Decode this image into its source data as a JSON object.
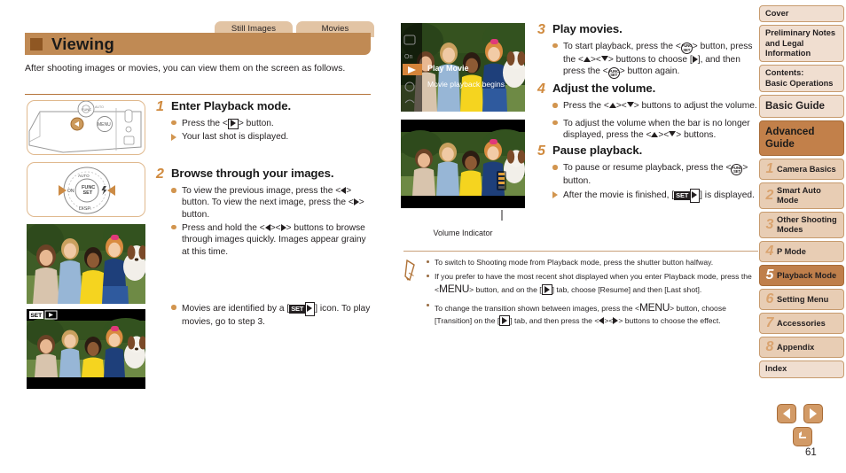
{
  "tabs": [
    {
      "label": "Still Images"
    },
    {
      "label": "Movies"
    }
  ],
  "title": "Viewing",
  "intro": "After shooting images or movies, you can view them on the screen as follows.",
  "page_number": "61",
  "colors": {
    "accent_brown": "#c08a54",
    "dark_brown": "#8f5723",
    "tab_tan": "#e2c4a4",
    "bullet_orange": "#d2954f",
    "step_number": "#d08a3e",
    "sidebar_bg": "#f0ded0",
    "sidebar_active": "#bf7f4b",
    "sidebar_advanced": "#c2804a"
  },
  "steps": [
    {
      "num": "1",
      "title": "Enter Playback mode.",
      "bullets": [
        {
          "marker": "dot",
          "text_before": "Press the <",
          "key": "playback-button",
          "text_after": "> button."
        },
        {
          "marker": "triangle",
          "text": "Your last shot is displayed."
        }
      ]
    },
    {
      "num": "2",
      "title": "Browse through your images.",
      "bullets": [
        {
          "marker": "dot",
          "text": "To view the previous image, press the < > button. To view the next image, press the < > button."
        },
        {
          "marker": "dot",
          "text": "Press and hold the < >< > buttons to browse through images quickly. Images appear grainy at this time."
        }
      ]
    },
    {
      "num": "3",
      "title": "Play movies.",
      "bullets": [
        {
          "marker": "dot",
          "text": "To start playback, press the < > button, press the < >< > buttons to choose [ ], and then press the < > button again."
        }
      ]
    },
    {
      "num": "4",
      "title": "Adjust the volume.",
      "bullets": [
        {
          "marker": "dot",
          "text": "Press the < >< > buttons to adjust the volume."
        },
        {
          "marker": "dot",
          "text": "To adjust the volume when the bar is no longer displayed, press the < >< > buttons."
        }
      ]
    },
    {
      "num": "5",
      "title": "Pause playback.",
      "bullets": [
        {
          "marker": "dot",
          "text": "To pause or resume playback, press the < > button."
        },
        {
          "marker": "triangle",
          "text": "After the movie is finished, [ ] is displayed."
        }
      ]
    }
  ],
  "movies_note": "Movies are identified by a [",
  "movies_note_2": "] icon. To play movies, go to step 3.",
  "screens": {
    "play_movie_label": "Play Movie",
    "play_movie_sub": "Movie playback begins",
    "volume_caption": "Volume Indicator",
    "set_play_badge": "SET"
  },
  "notes": [
    {
      "text": "To switch to Shooting mode from Playback mode, press the shutter button halfway."
    },
    {
      "text": "If you prefer to have the most recent shot displayed when you enter Playback mode, press the <MENU> button, and on the [ ] tab, choose [Resume] and then [Last shot]."
    },
    {
      "text": "To change the transition shown between images, press the <MENU> button, choose [Transition] on the [ ] tab, and then press the < >< > buttons to choose the effect."
    }
  ],
  "sidebar": {
    "top_items": [
      {
        "label": "Cover"
      },
      {
        "label": "Preliminary Notes and Legal Information"
      },
      {
        "label": "Contents:\nBasic Operations"
      }
    ],
    "basic_guide": "Basic Guide",
    "advanced_guide": "Advanced Guide",
    "chapters": [
      {
        "num": "1",
        "label": "Camera Basics",
        "active": false
      },
      {
        "num": "2",
        "label": "Smart Auto Mode",
        "active": false
      },
      {
        "num": "3",
        "label": "Other Shooting Modes",
        "active": false
      },
      {
        "num": "4",
        "label": "P Mode",
        "active": false
      },
      {
        "num": "5",
        "label": "Playback Mode",
        "active": true
      },
      {
        "num": "6",
        "label": "Setting Menu",
        "active": false
      },
      {
        "num": "7",
        "label": "Accessories",
        "active": false
      },
      {
        "num": "8",
        "label": "Appendix",
        "active": false
      }
    ],
    "index": "Index"
  },
  "nav_buttons": {
    "prev": "previous-page",
    "next": "next-page",
    "home": "home"
  }
}
